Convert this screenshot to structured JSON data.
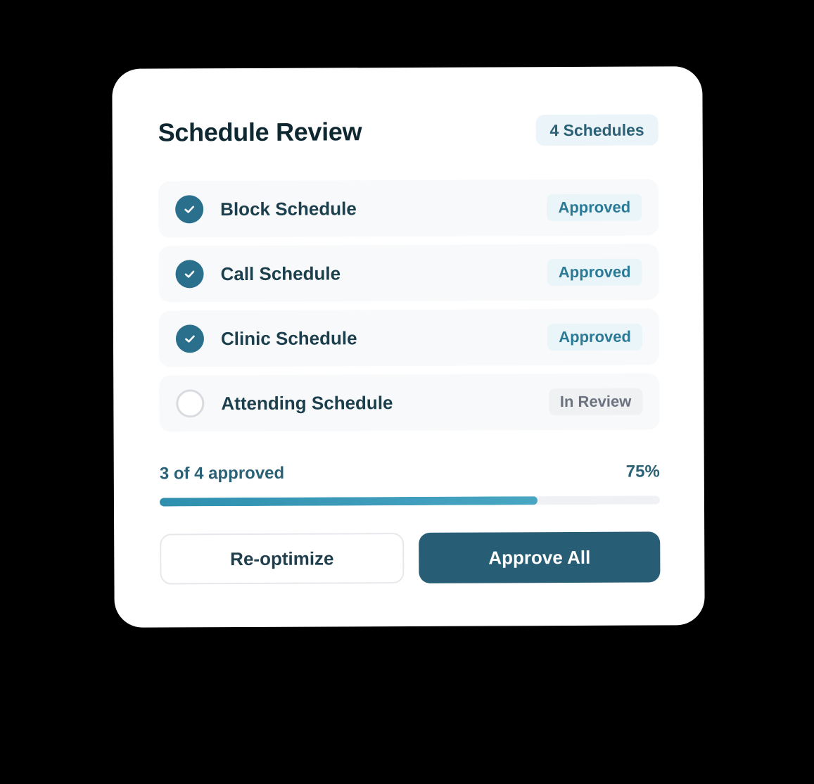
{
  "card": {
    "title": "Schedule Review",
    "count_badge": "4 Schedules"
  },
  "colors": {
    "title": "#0f2731",
    "accent": "#2a6f8c",
    "primary_button": "#275d75",
    "approved_bg": "#eaf5fa",
    "approved_text": "#2a7a96",
    "review_bg": "#f0f1f3",
    "review_text": "#6b7280",
    "row_bg": "#f8f9fa",
    "badge_bg": "#eaf4f9"
  },
  "schedules": [
    {
      "label": "Block Schedule",
      "status": "Approved",
      "approved": true,
      "icon": "check-circle-icon"
    },
    {
      "label": "Call Schedule",
      "status": "Approved",
      "approved": true,
      "icon": "check-circle-icon"
    },
    {
      "label": "Clinic Schedule",
      "status": "Approved",
      "approved": true,
      "icon": "check-circle-icon"
    },
    {
      "label": "Attending Schedule",
      "status": "In Review",
      "approved": false,
      "icon": "empty-circle-icon"
    }
  ],
  "progress": {
    "label": "3 of 4 approved",
    "percent_label": "75%",
    "fraction": 0.755
  },
  "actions": {
    "secondary_label": "Re-optimize",
    "primary_label": "Approve All"
  }
}
